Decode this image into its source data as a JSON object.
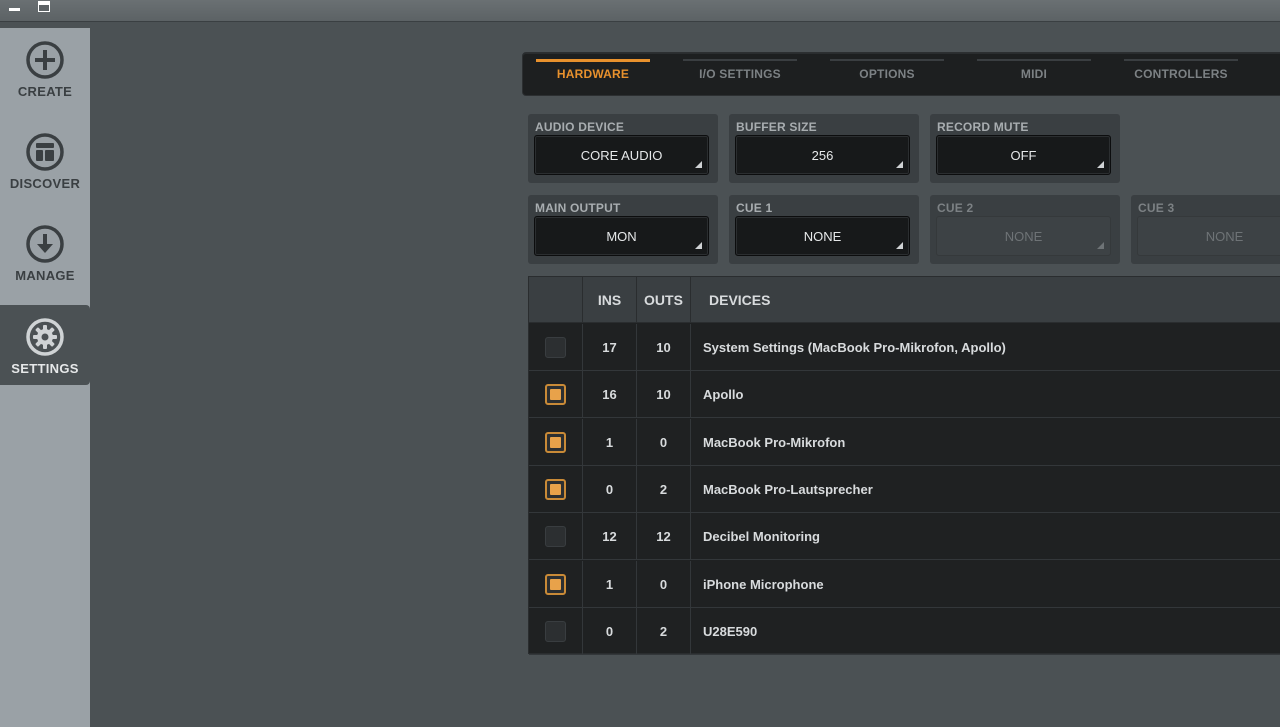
{
  "sidebar": {
    "items": [
      {
        "label": "CREATE",
        "icon": "plus-circle-icon"
      },
      {
        "label": "DISCOVER",
        "icon": "layout-icon"
      },
      {
        "label": "MANAGE",
        "icon": "download-circle-icon"
      },
      {
        "label": "SETTINGS",
        "icon": "gear-icon",
        "active": true
      }
    ]
  },
  "tabs": [
    {
      "label": "HARDWARE",
      "active": true
    },
    {
      "label": "I/O SETTINGS"
    },
    {
      "label": "OPTIONS"
    },
    {
      "label": "MIDI"
    },
    {
      "label": "CONTROLLERS"
    }
  ],
  "settings": {
    "audio_device": {
      "label": "AUDIO DEVICE",
      "value": "CORE AUDIO"
    },
    "buffer_size": {
      "label": "BUFFER SIZE",
      "value": "256"
    },
    "record_mute": {
      "label": "RECORD MUTE",
      "value": "OFF"
    },
    "main_output": {
      "label": "MAIN OUTPUT",
      "value": "MON"
    },
    "cue1": {
      "label": "CUE 1",
      "value": "NONE"
    },
    "cue2": {
      "label": "CUE 2",
      "value": "NONE"
    },
    "cue3": {
      "label": "CUE 3",
      "value": "NONE"
    }
  },
  "devices": {
    "headers": {
      "ins": "INS",
      "outs": "OUTS",
      "devices": "DEVICES"
    },
    "rows": [
      {
        "checked": false,
        "ins": "17",
        "outs": "10",
        "name": "System Settings (MacBook Pro-Mikrofon, Apollo)"
      },
      {
        "checked": true,
        "ins": "16",
        "outs": "10",
        "name": "Apollo"
      },
      {
        "checked": true,
        "ins": "1",
        "outs": "0",
        "name": "MacBook Pro-Mikrofon"
      },
      {
        "checked": true,
        "ins": "0",
        "outs": "2",
        "name": "MacBook Pro-Lautsprecher"
      },
      {
        "checked": false,
        "ins": "12",
        "outs": "12",
        "name": "Decibel Monitoring"
      },
      {
        "checked": true,
        "ins": "1",
        "outs": "0",
        "name": "iPhone Microphone"
      },
      {
        "checked": false,
        "ins": "0",
        "outs": "2",
        "name": "U28E590"
      }
    ]
  },
  "colors": {
    "accent": "#e8912d",
    "checkbox_on": "#e8a24a"
  }
}
